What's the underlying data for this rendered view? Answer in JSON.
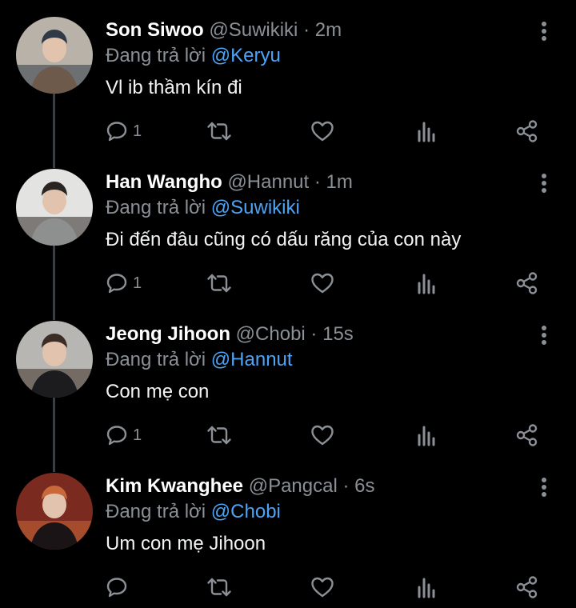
{
  "reply_prefix": "Đang trả lời",
  "tweets": [
    {
      "name": "Son Siwoo",
      "handle": "@Suwikiki",
      "separator": "·",
      "time": "2m",
      "reply_to": "@Keryu",
      "text": "Vl ib thầm kín đi",
      "reply_count": "1",
      "avatar_colors": [
        "#b9b2a8",
        "#6d5a4a",
        "#2f3a46"
      ]
    },
    {
      "name": "Han Wangho",
      "handle": "@Hannut",
      "separator": "·",
      "time": "1m",
      "reply_to": "@Suwikiki",
      "text": "Đi đến đâu cũng có dấu răng của con này",
      "reply_count": "1",
      "avatar_colors": [
        "#e3e3e1",
        "#8e8f8f",
        "#2a2522"
      ]
    },
    {
      "name": "Jeong Jihoon",
      "handle": "@Chobi",
      "separator": "·",
      "time": "15s",
      "reply_to": "@Hannut",
      "text": "Con mẹ con",
      "reply_count": "1",
      "avatar_colors": [
        "#b8b6b2",
        "#1c1c1e",
        "#3b2d25"
      ]
    },
    {
      "name": "Kim Kwanghee",
      "handle": "@Pangcal",
      "separator": "·",
      "time": "6s",
      "reply_to": "@Chobi",
      "text": "Um con mẹ Jihoon",
      "reply_count": "",
      "avatar_colors": [
        "#7a2a1e",
        "#1a1416",
        "#c9683a"
      ]
    }
  ],
  "icons": {
    "more": "more-vertical-icon",
    "reply": "reply-bubble-icon",
    "retweet": "retweet-icon",
    "like": "heart-icon",
    "views": "analytics-icon",
    "share": "share-icon"
  }
}
